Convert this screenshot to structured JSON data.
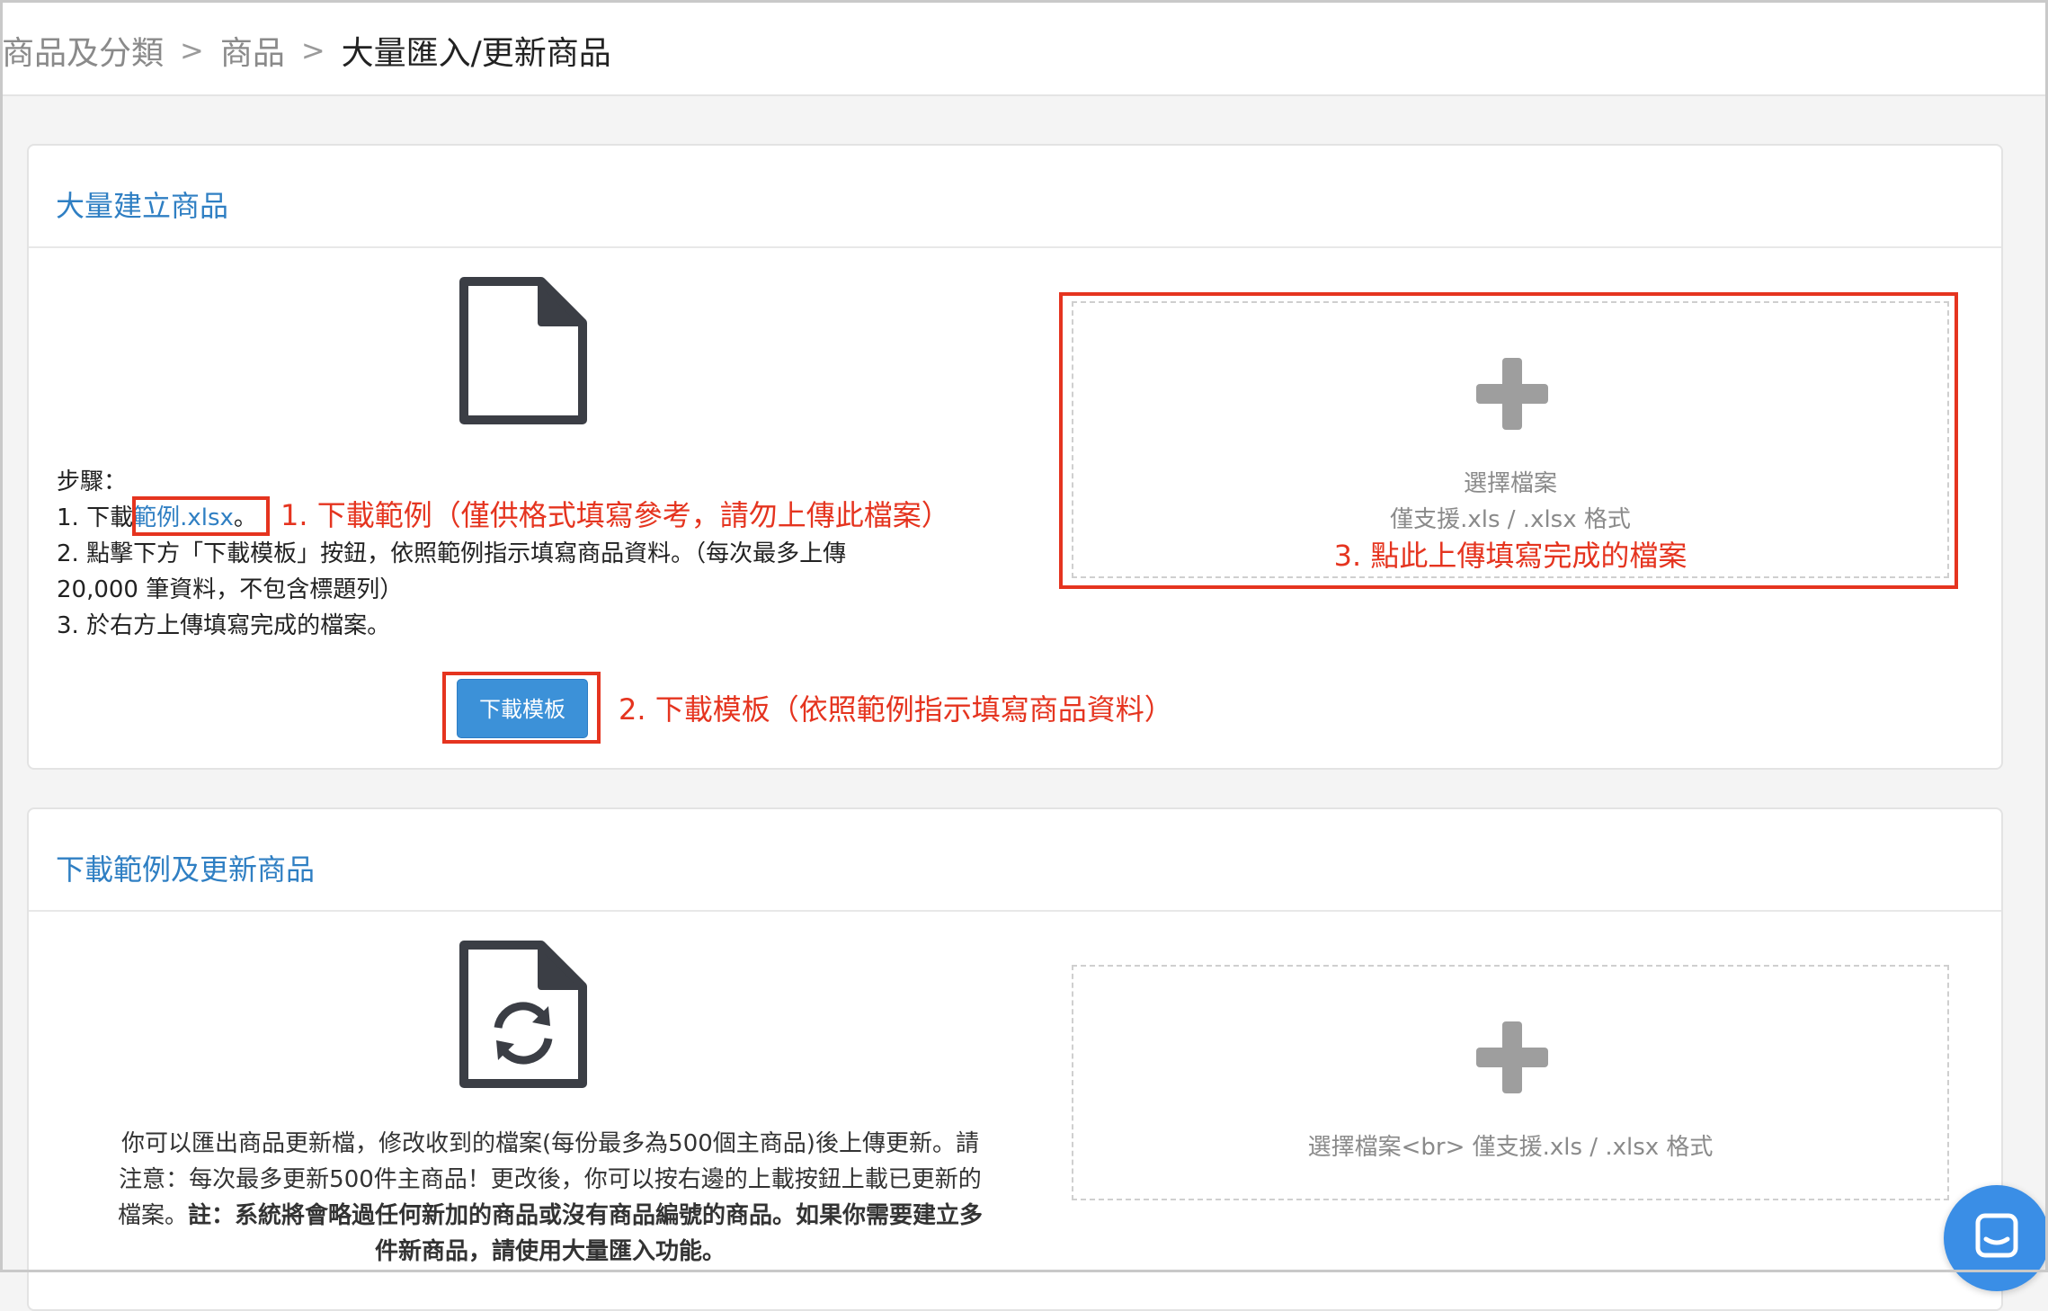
{
  "breadcrumb": {
    "items": [
      "商品及分類",
      "商品"
    ],
    "separator": ">",
    "current": "大量匯入/更新商品"
  },
  "bulk_create": {
    "title": "大量建立商品",
    "steps_heading": "步驟：",
    "step1_prefix": "1. 下載",
    "step1_link": "範例.xlsx",
    "step1_suffix": "。",
    "step2_line1": "2. 點擊下方「下載模板」按鈕，依照範例指示填寫商品資料。（每次最多上傳",
    "step2_line2": "20,000 筆資料，不包含標題列）",
    "step3": "3. 於右方上傳填寫完成的檔案。",
    "download_template_button": "下載模板",
    "dropzone": {
      "choose_file": "選擇檔案",
      "supported_formats": "僅支援.xls / .xlsx 格式"
    }
  },
  "annotations": {
    "note1": "1. 下載範例（僅供格式填寫參考，請勿上傳此檔案）",
    "note2": "2. 下載模板（依照範例指示填寫商品資料）",
    "note3": "3. 點此上傳填寫完成的檔案",
    "color": "#e5341f"
  },
  "bulk_update": {
    "title": "下載範例及更新商品",
    "description_line1": "你可以匯出商品更新檔，修改收到的檔案(每份最多為500個主商品)後上傳更新。請",
    "description_line2_normal": "注意：每次最多更新500件主商品！更改後，你可以按右邊的上載按鈕上載已更新的",
    "description_line3_normal": "檔案。",
    "description_line3_bold": "註：系統將會略過任何新加的商品或沒有商品編號的商品。如果你需要建立多",
    "description_line4_bold": "件新商品，請使用大量匯入功能。",
    "dropzone_text": "選擇檔案<br> 僅支援.xls / .xlsx 格式"
  },
  "icons": {
    "document": "file-icon",
    "refresh_document": "file-refresh-icon",
    "add": "plus-icon",
    "chat": "chat-icon"
  },
  "colors": {
    "link": "#2f7fc3",
    "button": "#3c91d8",
    "annotation": "#e5341f"
  }
}
